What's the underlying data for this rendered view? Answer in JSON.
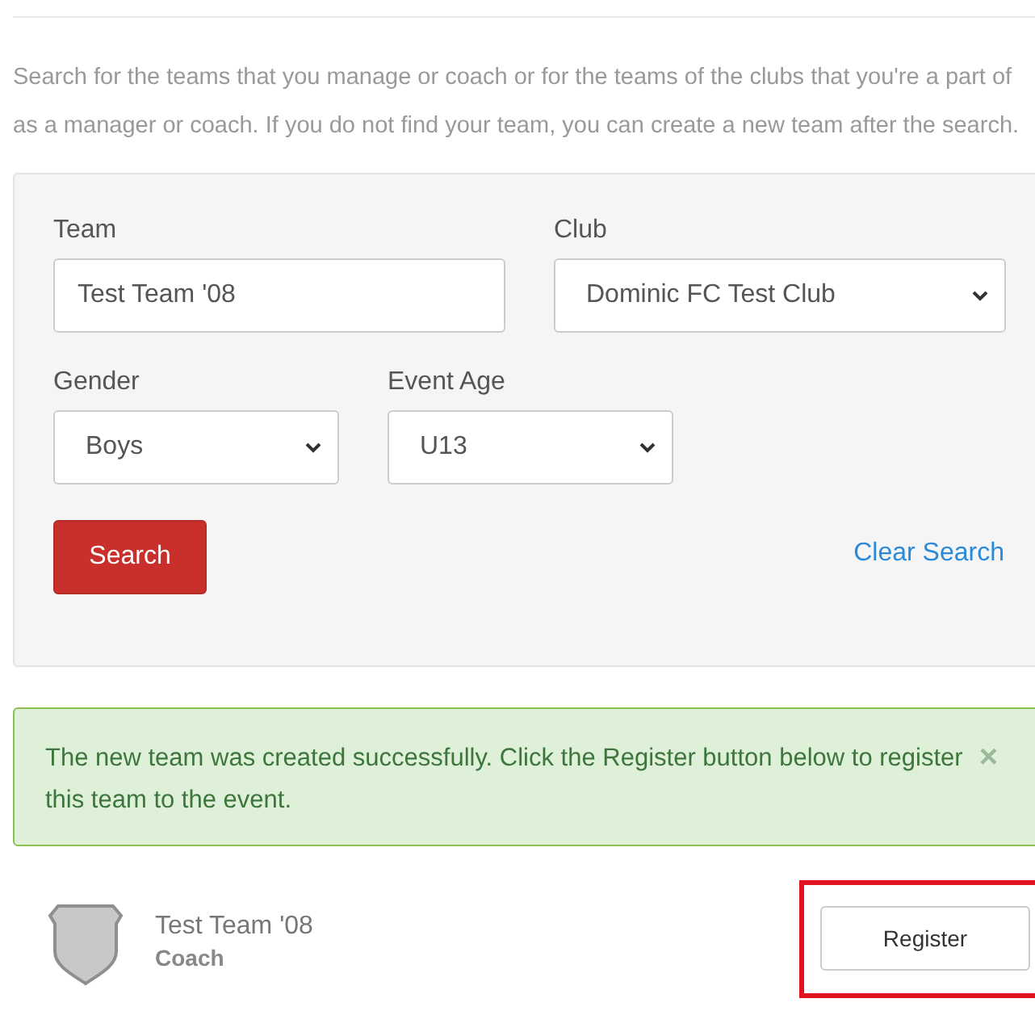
{
  "intro": "Search for the teams that you manage or coach or for the teams of the clubs that you're a part of as a manager or coach. If you do not find your team, you can create a new team after the search.",
  "search_panel": {
    "team": {
      "label": "Team",
      "value": "Test Team '08"
    },
    "club": {
      "label": "Club",
      "value": "Dominic FC Test Club"
    },
    "gender": {
      "label": "Gender",
      "value": "Boys"
    },
    "event_age": {
      "label": "Event Age",
      "value": "U13"
    },
    "search_button": "Search",
    "clear_link": "Clear Search"
  },
  "alert": {
    "message": "The new team was created successfully. Click the Register button below to register this team to the event.",
    "close": "×"
  },
  "results": [
    {
      "name": "Test Team '08",
      "role": "Coach",
      "button": "Register",
      "highlighted": true
    }
  ]
}
